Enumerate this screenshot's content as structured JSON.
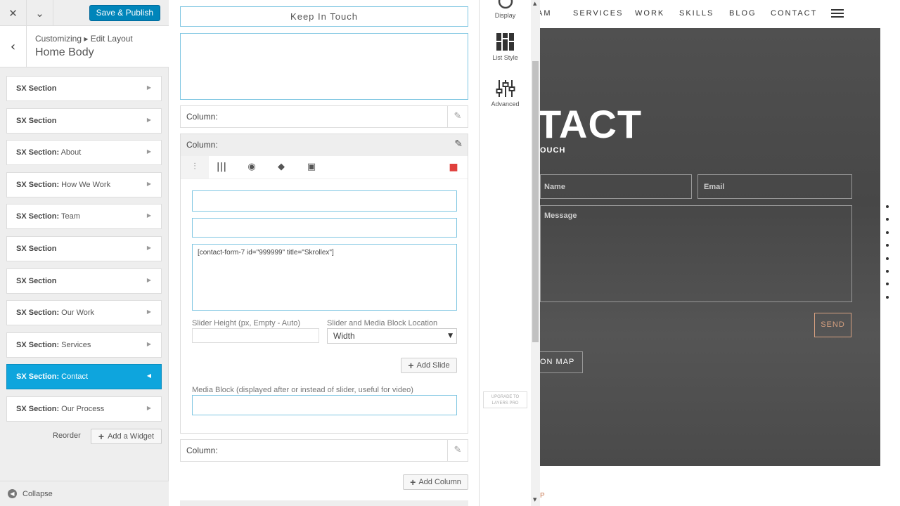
{
  "topbar": {
    "close_icon": "close-icon",
    "collapse_icon": "double-chevron-down-icon",
    "publish_label": "Save & Publish"
  },
  "header": {
    "crumb": "Customizing ▸ Edit Layout",
    "title": "Home Body"
  },
  "sidebar": {
    "sections": [
      {
        "prefix": "SX Section",
        "suffix": "",
        "active": false
      },
      {
        "prefix": "SX Section",
        "suffix": "",
        "active": false
      },
      {
        "prefix": "SX Section:",
        "suffix": " About",
        "active": false
      },
      {
        "prefix": "SX Section:",
        "suffix": " How We Work",
        "active": false
      },
      {
        "prefix": "SX Section:",
        "suffix": " Team",
        "active": false
      },
      {
        "prefix": "SX Section",
        "suffix": "",
        "active": false
      },
      {
        "prefix": "SX Section",
        "suffix": "",
        "active": false
      },
      {
        "prefix": "SX Section:",
        "suffix": " Our Work",
        "active": false
      },
      {
        "prefix": "SX Section:",
        "suffix": " Services",
        "active": false
      },
      {
        "prefix": "SX Section:",
        "suffix": " Contact",
        "active": true
      },
      {
        "prefix": "SX Section:",
        "suffix": " Our Process",
        "active": false
      }
    ],
    "reorder_label": "Reorder",
    "add_widget_label": "Add a Widget",
    "collapse_label": "Collapse"
  },
  "widget": {
    "title_value": "Keep In Touch",
    "columns": [
      {
        "label": "Column:"
      },
      {
        "label": "Column:"
      },
      {
        "label": "Column:"
      }
    ],
    "content_value": "[contact-form-7 id=\"999999\" title=\"Skrollex\"]",
    "slider_height_label": "Slider Height (px, Empty - Auto)",
    "location_label": "Slider and Media Block Location",
    "location_value": "Width",
    "add_slide_label": "Add Slide",
    "media_block_label": "Media Block (displayed after or instead of slider, useful for video)",
    "add_column_label": "Add Column"
  },
  "iconbar": {
    "display_label": "Display",
    "list_style_label": "List Style",
    "advanced_label": "Advanced",
    "upgrade_line1": "UPGRADE TO",
    "upgrade_line2": "LAYERS PRO"
  },
  "preview": {
    "nav": [
      "AM",
      "SERVICES",
      "WORK",
      "SKILLS",
      "BLOG",
      "CONTACT"
    ],
    "hero_title": "TACT",
    "hero_subtitle": "OUCH",
    "name_placeholder": "Name",
    "email_placeholder": "Email",
    "message_placeholder": "Message",
    "send_label": "SEND",
    "map_label": "ON MAP",
    "next_section_fragment": "P",
    "dot_count": 8
  },
  "colors": {
    "accent": "#0ea5dd",
    "publish": "#0085ba",
    "delete": "#e0403c",
    "send": "#d6a080"
  }
}
